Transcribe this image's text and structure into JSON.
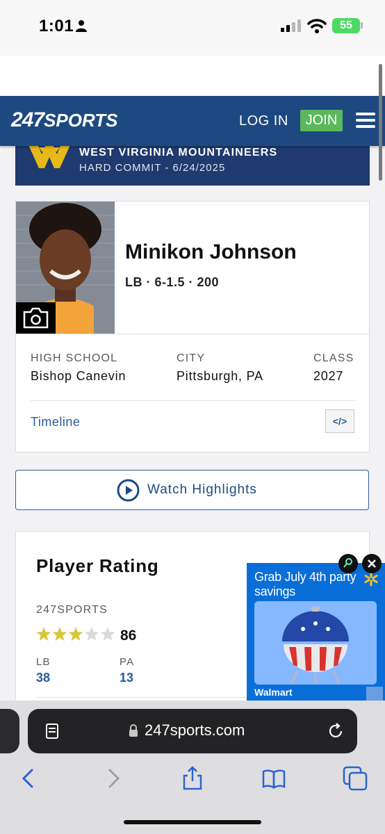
{
  "status_bar": {
    "time": "1:01",
    "battery_percent": "55"
  },
  "header": {
    "logo_247": "247",
    "logo_sports": "SPORTS",
    "login_label": "LOG IN",
    "join_label": "JOIN"
  },
  "commitment": {
    "team": "WEST VIRGINIA MOUNTAINEERS",
    "status": "HARD COMMIT - 6/24/2025"
  },
  "player": {
    "name": "Minikon Johnson",
    "meta": "LB · 6-1.5 · 200",
    "high_school_label": "HIGH SCHOOL",
    "high_school": "Bishop Canevin",
    "city_label": "CITY",
    "city": "Pittsburgh, PA",
    "class_label": "CLASS",
    "class_year": "2027",
    "timeline_label": "Timeline",
    "embed_label": "</>"
  },
  "highlights": {
    "label": "Watch Highlights"
  },
  "rating": {
    "title": "Player Rating",
    "source": "247SPORTS",
    "stars_filled": 3,
    "stars_total": 5,
    "score": "86",
    "position_label": "LB",
    "position_rank": "38",
    "state_label": "PA",
    "state_rank": "13"
  },
  "ad": {
    "headline": "Grab July 4th party savings",
    "brand": "Walmart"
  },
  "browser": {
    "url": "247sports.com"
  },
  "colors": {
    "header_blue": "#1e4980",
    "join_green": "#5cb85c",
    "link_blue": "#2a5a9a",
    "star_gold": "#d8c63a",
    "ad_blue": "#0a6ed9"
  }
}
